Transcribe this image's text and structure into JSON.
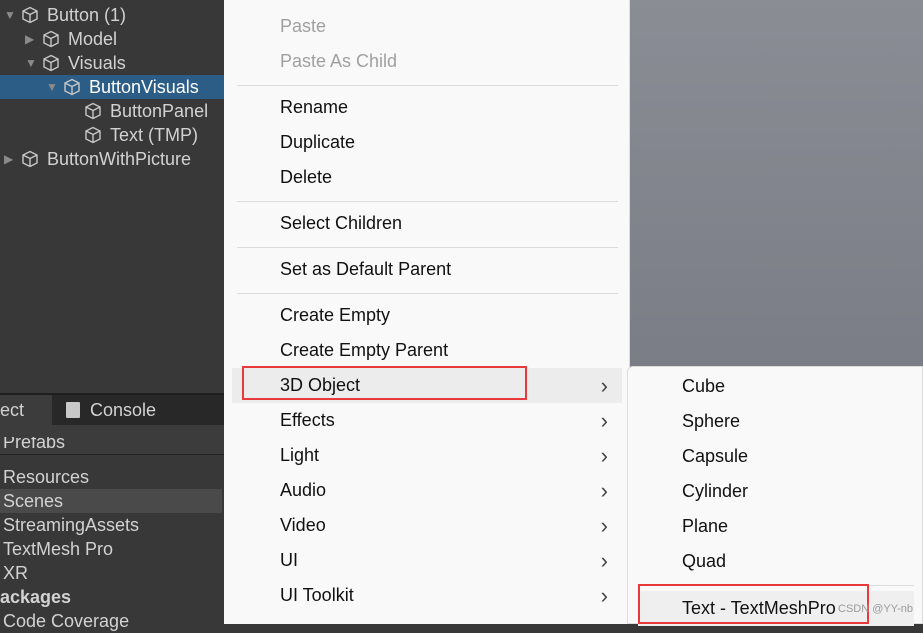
{
  "hierarchy": {
    "items": [
      {
        "label": "Button (1)",
        "indent": 0,
        "arrow": "down"
      },
      {
        "label": "Model",
        "indent": 1,
        "arrow": "right"
      },
      {
        "label": "Visuals",
        "indent": 1,
        "arrow": "down"
      },
      {
        "label": "ButtonVisuals",
        "indent": 2,
        "arrow": "down",
        "selected": true
      },
      {
        "label": "ButtonPanel",
        "indent": 3,
        "arrow": ""
      },
      {
        "label": "Text (TMP)",
        "indent": 3,
        "arrow": ""
      },
      {
        "label": "ButtonWithPicture",
        "indent": 0,
        "arrow": "right"
      }
    ]
  },
  "bottom_tabs": {
    "project": "ect",
    "console": "Console"
  },
  "project": {
    "items": [
      "Prefabs",
      "Resources",
      "Scenes",
      "StreamingAssets",
      "TextMesh Pro",
      "XR",
      "ackages",
      "Code Coverage"
    ],
    "highlighted": "Scenes"
  },
  "context_menu": {
    "items": [
      {
        "label": "Paste",
        "disabled": true
      },
      {
        "label": "Paste As Child",
        "disabled": true
      },
      {
        "label": "Rename"
      },
      {
        "label": "Duplicate"
      },
      {
        "label": "Delete"
      },
      {
        "label": "Select Children"
      },
      {
        "label": "Set as Default Parent"
      },
      {
        "label": "Create Empty"
      },
      {
        "label": "Create Empty Parent"
      },
      {
        "label": "3D Object",
        "submenu": true,
        "hovered": true
      },
      {
        "label": "Effects",
        "submenu": true
      },
      {
        "label": "Light",
        "submenu": true
      },
      {
        "label": "Audio",
        "submenu": true
      },
      {
        "label": "Video",
        "submenu": true
      },
      {
        "label": "UI",
        "submenu": true
      },
      {
        "label": "UI Toolkit",
        "submenu": true
      }
    ]
  },
  "submenu_3d_object": {
    "items": [
      "Cube",
      "Sphere",
      "Capsule",
      "Cylinder",
      "Plane",
      "Quad",
      "Text - TextMeshPro"
    ]
  },
  "watermark": "CSDN @YY-nb",
  "colors": {
    "selection": "#2c5d87",
    "highlight_box": "#e83a3a"
  }
}
